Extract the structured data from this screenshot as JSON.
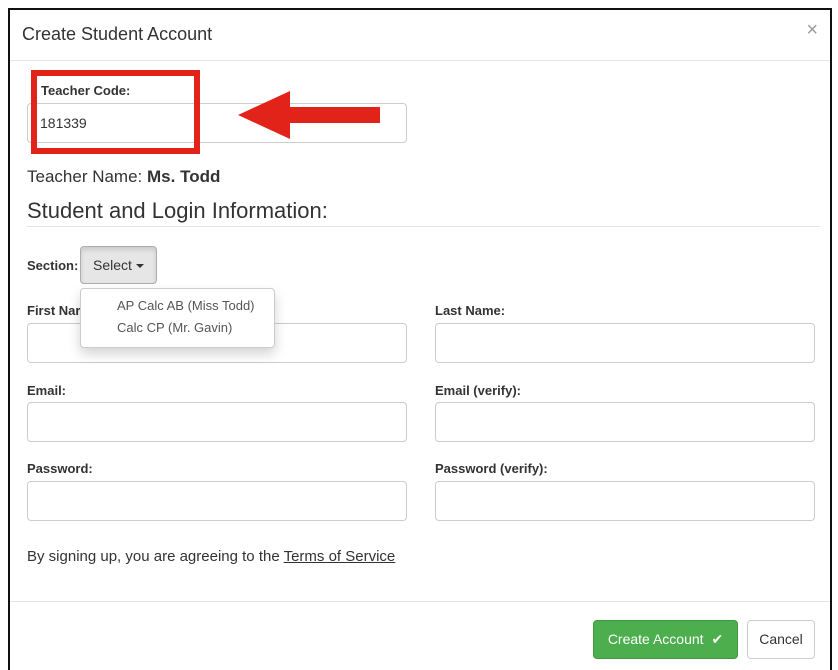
{
  "modal": {
    "title": "Create Student Account",
    "close_glyph": "×"
  },
  "teacher_code": {
    "label": "Teacher Code:",
    "value": "181339"
  },
  "teacher_name": {
    "label": "Teacher Name:",
    "value": "Ms. Todd"
  },
  "student_section_heading": "Student and Login Information:",
  "section": {
    "label": "Section:",
    "button_label": "Select",
    "options": [
      "AP Calc AB (Miss Todd)",
      "Calc CP (Mr. Gavin)"
    ]
  },
  "fields": {
    "first_name_label": "First Nar",
    "last_name_label": "Last Name:",
    "email_label": "Email:",
    "email_verify_label": "Email (verify):",
    "password_label": "Password:",
    "password_verify_label": "Password (verify):"
  },
  "terms": {
    "prefix": "By signing up, you are agreeing to the ",
    "link": "Terms of Service"
  },
  "footer": {
    "create_label": "Create Account",
    "create_icon": "✔",
    "cancel_label": "Cancel"
  },
  "colors": {
    "highlight": "#e2231a",
    "success": "#4cae4c"
  }
}
